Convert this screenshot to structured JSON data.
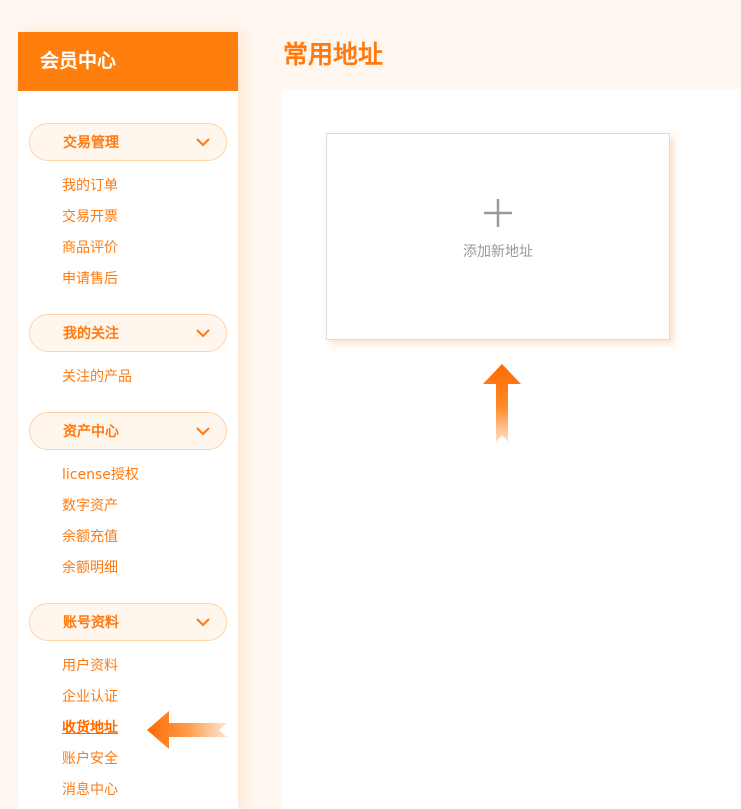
{
  "sidebar": {
    "title": "会员中心",
    "groups": [
      {
        "label": "交易管理",
        "items": [
          "我的订单",
          "交易开票",
          "商品评价",
          "申请售后"
        ]
      },
      {
        "label": "我的关注",
        "items": [
          "关注的产品"
        ]
      },
      {
        "label": "资产中心",
        "items": [
          "license授权",
          "数字资产",
          "余额充值",
          "余额明细"
        ]
      },
      {
        "label": "账号资料",
        "items": [
          "用户资料",
          "企业认证",
          "收货地址",
          "账户安全",
          "消息中心"
        ]
      }
    ],
    "active_item": "收货地址"
  },
  "main": {
    "title": "常用地址",
    "add_card_label": "添加新地址"
  },
  "colors": {
    "accent": "#ff7f0e",
    "accent_text": "#ff7a10",
    "background": "#fff7f0",
    "card_border": "#dcdcdc",
    "muted_text": "#999999"
  }
}
